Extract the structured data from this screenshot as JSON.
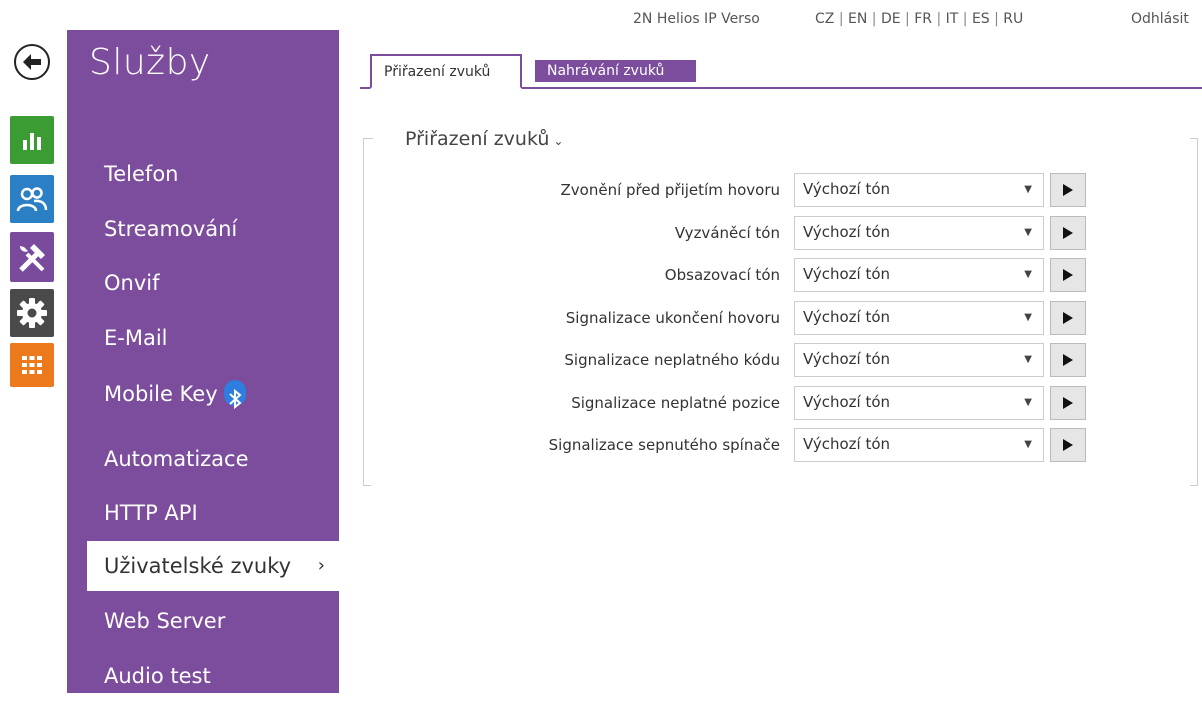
{
  "header": {
    "device_name": "2N Helios IP Verso",
    "languages": [
      "CZ",
      "EN",
      "DE",
      "FR",
      "IT",
      "ES",
      "RU"
    ],
    "logout_label": "Odhlásit"
  },
  "rail": {
    "icons": [
      "back-arrow-icon",
      "status-chart-icon",
      "users-icon",
      "tools-icon",
      "gear-icon",
      "apps-grid-icon"
    ],
    "colors": {
      "status": "#3c9c34",
      "users": "#2b7fc5",
      "tools": "#7a4a9c",
      "gear": "#4a4a4a",
      "apps": "#ec7a1c"
    }
  },
  "sidemenu": {
    "title": "Služby",
    "items": [
      {
        "label": "Telefon"
      },
      {
        "label": "Streamování"
      },
      {
        "label": "Onvif"
      },
      {
        "label": "E-Mail"
      },
      {
        "label": "Mobile Key"
      },
      {
        "label": "Automatizace"
      },
      {
        "label": "HTTP API"
      },
      {
        "label": "Uživatelské zvuky",
        "active": true
      },
      {
        "label": "Web Server"
      },
      {
        "label": "Audio test"
      }
    ],
    "active_chevron": "›",
    "accent_color": "#7b4d9c"
  },
  "tabs": [
    {
      "label": "Přiřazení zvuků",
      "active": true
    },
    {
      "label": "Nahrávání zvuků",
      "active": false
    }
  ],
  "panel": {
    "title": "Přiřazení zvuků",
    "rows": [
      {
        "label": "Zvonění před přijetím hovoru",
        "value": "Výchozí tón"
      },
      {
        "label": "Vyzváněcí tón",
        "value": "Výchozí tón"
      },
      {
        "label": "Obsazovací tón",
        "value": "Výchozí tón"
      },
      {
        "label": "Signalizace ukončení hovoru",
        "value": "Výchozí tón"
      },
      {
        "label": "Signalizace neplatného kódu",
        "value": "Výchozí tón"
      },
      {
        "label": "Signalizace neplatné pozice",
        "value": "Výchozí tón"
      },
      {
        "label": "Signalizace sepnutého spínače",
        "value": "Výchozí tón"
      }
    ]
  }
}
